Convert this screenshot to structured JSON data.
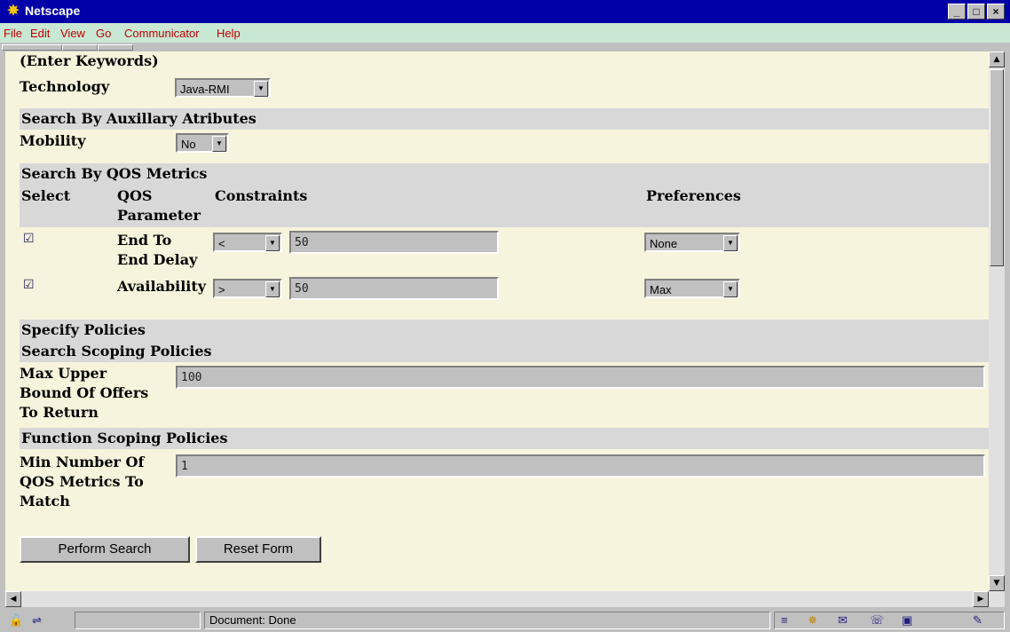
{
  "window": {
    "title": "Netscape",
    "buttons": {
      "minimize": "_",
      "maximize": "□",
      "close": "×"
    }
  },
  "menu": [
    "File",
    "Edit",
    "View",
    "Go",
    "Communicator",
    "Help"
  ],
  "form": {
    "keywords_hint": "(Enter Keywords)",
    "technology": {
      "label": "Technology",
      "value": "Java-RMI"
    },
    "aux_heading": "Search By Auxillary Atributes",
    "mobility": {
      "label": "Mobility",
      "value": "No"
    },
    "qos_heading": "Search By QOS Metrics",
    "qos_columns": {
      "select": "Select",
      "param_line1": "QOS",
      "param_line2": "Parameter",
      "constraints": "Constraints",
      "preferences": "Preferences"
    },
    "qos_rows": [
      {
        "checked": true,
        "param_line1": "End To",
        "param_line2": "End Delay",
        "operator": "<",
        "value": "50",
        "preference": "None"
      },
      {
        "checked": true,
        "param_line1": "Availability",
        "param_line2": "",
        "operator": ">",
        "value": "50",
        "preference": "Max"
      }
    ],
    "policies_heading": "Specify Policies",
    "scoping_heading": "Search Scoping Policies",
    "max_offers": {
      "line1": "Max Upper",
      "line2": "Bound Of Offers",
      "line3": "To Return",
      "value": "100"
    },
    "function_heading": "Function Scoping Policies",
    "min_metrics": {
      "line1": "Min Number Of",
      "line2": "QOS Metrics To",
      "line3": "Match",
      "value": "1"
    },
    "search_button": "Perform Search",
    "reset_button": "Reset Form"
  },
  "status": {
    "text": "Document: Done"
  },
  "icons": [
    "netscape-logo-icon",
    "lock-icon",
    "connection-icon",
    "menu-icon",
    "navigator-icon",
    "mail-icon",
    "discussions-icon",
    "composer-icon",
    "edit-icon"
  ]
}
